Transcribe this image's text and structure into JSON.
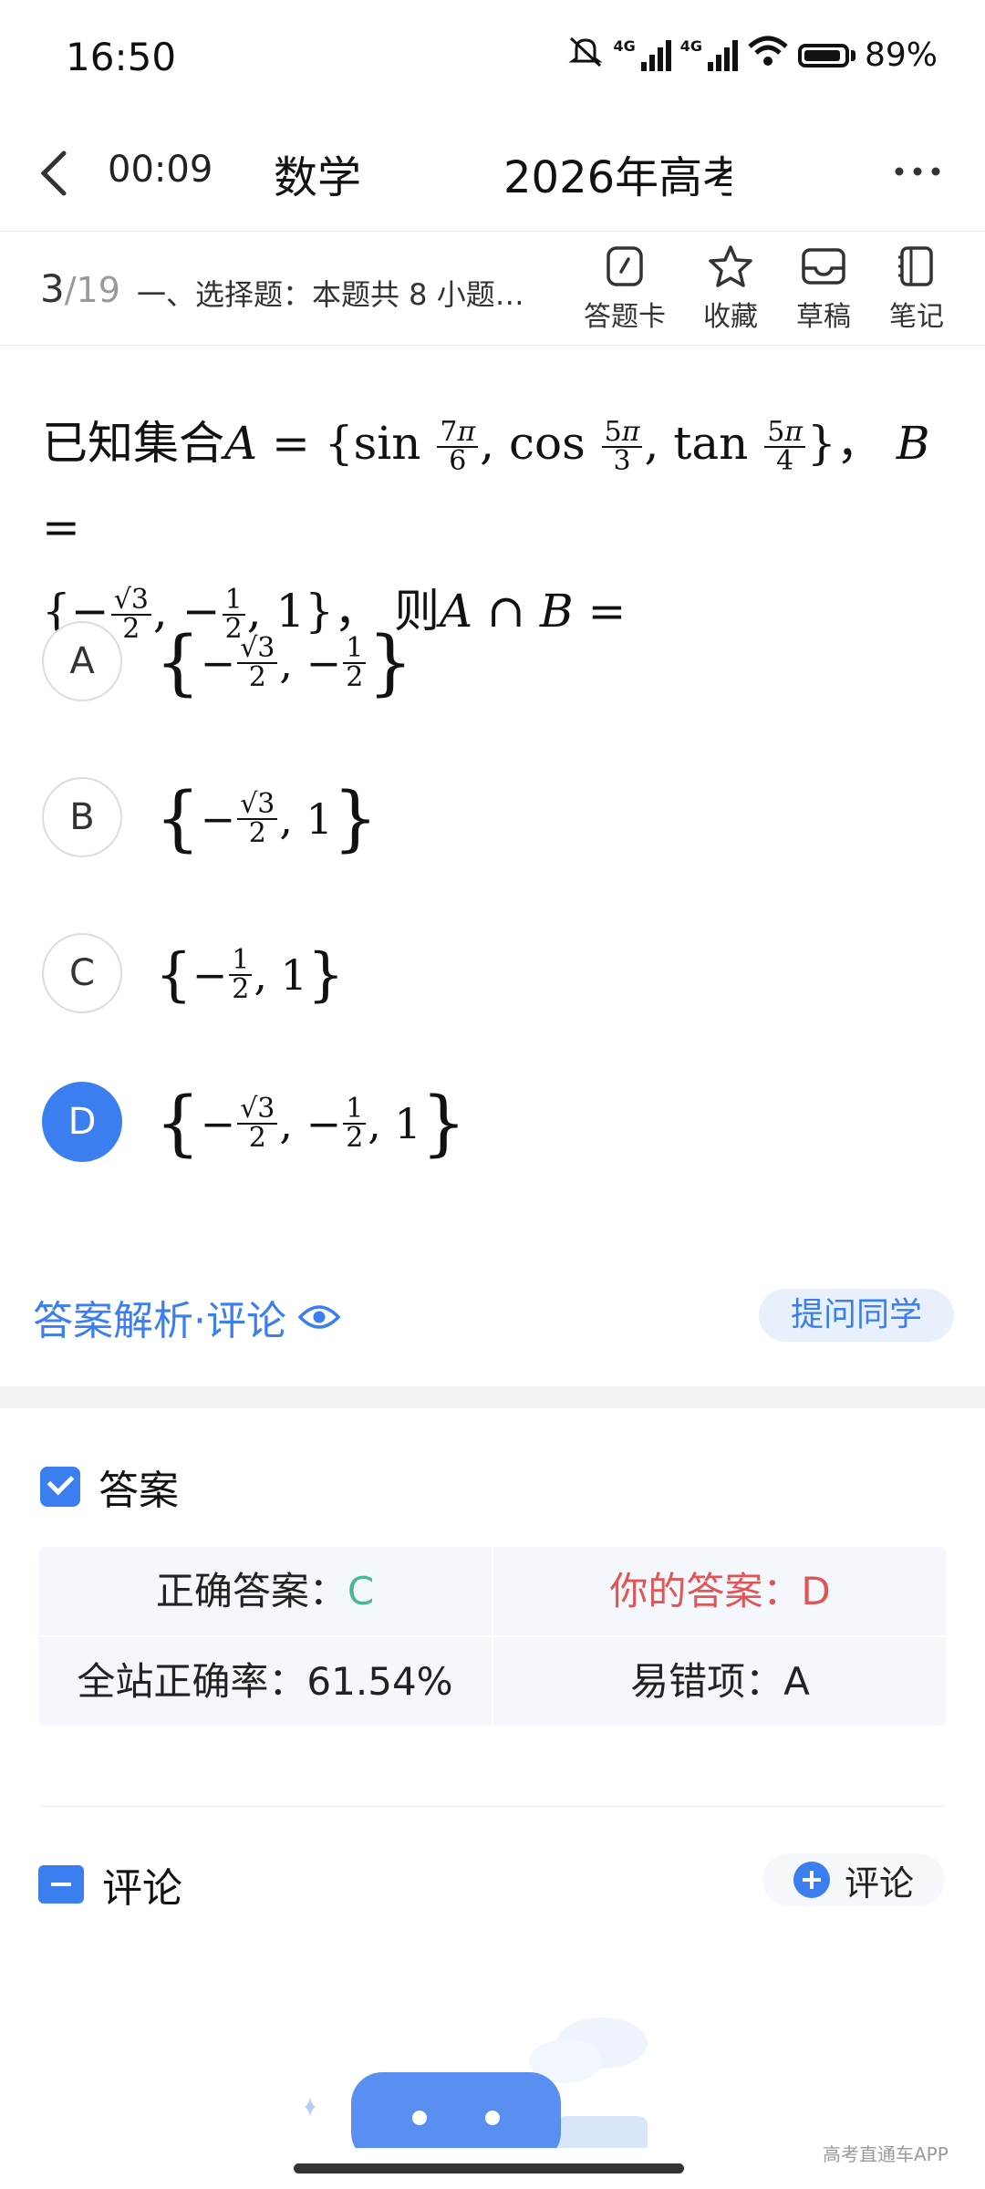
{
  "status_bar": {
    "time": "16:50",
    "network_1": "4G",
    "network_2": "4G",
    "battery": "89%"
  },
  "header": {
    "timer": "00:09",
    "subject": "数学",
    "paper_title": "2026年高考"
  },
  "subbar": {
    "current": "3",
    "total": "/19",
    "section": "一、选择题：本题共 8 小题…",
    "tools": [
      "答题卡",
      "收藏",
      "草稿",
      "笔记"
    ]
  },
  "question": {
    "prefix": "已知集合",
    "then": "则",
    "set_a": "A",
    "set_b": "B"
  },
  "options": [
    {
      "letter": "A",
      "selected": false
    },
    {
      "letter": "B",
      "selected": false
    },
    {
      "letter": "C",
      "selected": false
    },
    {
      "letter": "D",
      "selected": true
    }
  ],
  "analysis": {
    "link_label": "答案解析·评论",
    "ask_label": "提问同学"
  },
  "answer": {
    "heading": "答案",
    "correct_label": "正确答案：",
    "correct_value": "C",
    "yours_label": "你的答案：",
    "yours_value": "D",
    "rate_label": "全站正确率：",
    "rate_value": "61.54%",
    "error_label": "易错项：",
    "error_value": "A"
  },
  "comments": {
    "heading": "评论",
    "button_label": "评论"
  },
  "watermark": "高考直通车APP",
  "colors": {
    "accent": "#3a7ef0",
    "correct": "#47b891",
    "wrong": "#e05555"
  }
}
